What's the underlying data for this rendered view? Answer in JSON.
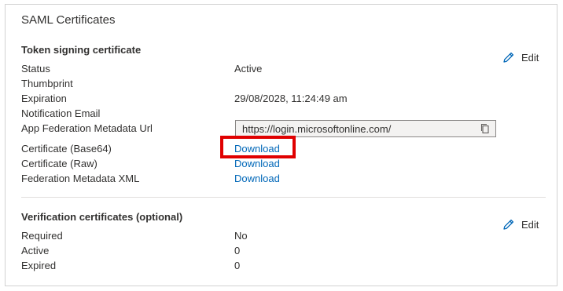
{
  "card": {
    "title": "SAML Certificates"
  },
  "token_signing": {
    "heading": "Token signing certificate",
    "edit_label": "Edit",
    "rows": [
      {
        "label": "Status",
        "value": "Active"
      },
      {
        "label": "Thumbprint",
        "value": ""
      },
      {
        "label": "Expiration",
        "value": "29/08/2028, 11:24:49 am"
      },
      {
        "label": "Notification Email",
        "value": ""
      },
      {
        "label": "App Federation Metadata Url",
        "value": "https://login.microsoftonline.com/"
      },
      {
        "label": "Certificate (Base64)",
        "value": "Download"
      },
      {
        "label": "Certificate (Raw)",
        "value": "Download"
      },
      {
        "label": "Federation Metadata XML",
        "value": "Download"
      }
    ]
  },
  "verification": {
    "heading": "Verification certificates (optional)",
    "edit_label": "Edit",
    "rows": [
      {
        "label": "Required",
        "value": "No"
      },
      {
        "label": "Active",
        "value": "0"
      },
      {
        "label": "Expired",
        "value": "0"
      }
    ]
  },
  "icons": {
    "edit": "pencil-icon",
    "copy": "copy-icon"
  },
  "colors": {
    "link": "#0067b8",
    "highlight": "#e00000",
    "border": "#d2d2d2"
  }
}
